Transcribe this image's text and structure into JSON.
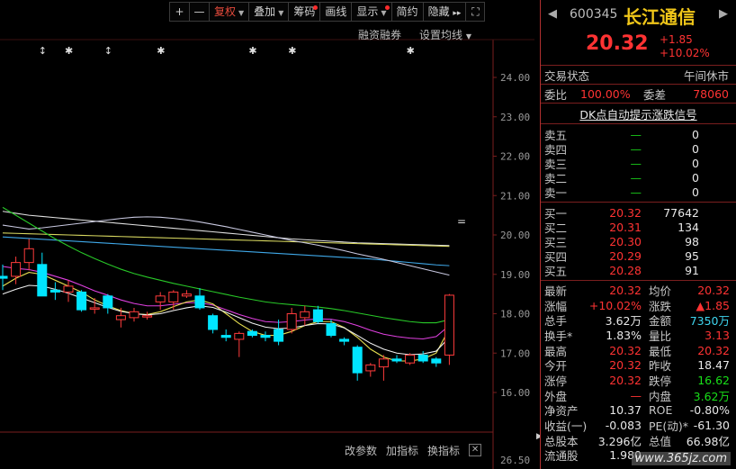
{
  "toolbar": {
    "zoom_in": "+",
    "zoom_out": "—",
    "fuquan": "复权",
    "overlay": "叠加",
    "chips": "筹码",
    "draw": "画线",
    "display": "显示",
    "simple": "简约",
    "hide": "隐藏",
    "collapse": "▸▸",
    "fullscreen": "⛶"
  },
  "sub_toolbar": {
    "margin": "融资融券",
    "ma_settings": "设置均线"
  },
  "bottom_toolbar": {
    "change_params": "改参数",
    "add_indicator": "加指标",
    "switch_indicator": "换指标",
    "close": "✕"
  },
  "chart_data": {
    "type": "candlestick",
    "yticks": [
      "24.00",
      "23.00",
      "22.00",
      "21.00",
      "20.00",
      "19.00",
      "18.00",
      "17.00",
      "16.00"
    ],
    "ylim": [
      15.8,
      24.2
    ],
    "lower_pane_tick": "26.50",
    "markers": [
      "↕",
      "✱",
      "↕",
      "✱",
      "✱",
      "✱",
      "✱"
    ],
    "candles": [
      {
        "o": 18.95,
        "h": 19.25,
        "l": 18.6,
        "c": 18.9
      },
      {
        "o": 18.95,
        "h": 19.45,
        "l": 18.75,
        "c": 19.3
      },
      {
        "o": 19.3,
        "h": 19.9,
        "l": 19.1,
        "c": 19.65
      },
      {
        "o": 19.25,
        "h": 19.55,
        "l": 18.5,
        "c": 18.45
      },
      {
        "o": 18.6,
        "h": 18.8,
        "l": 18.35,
        "c": 18.55
      },
      {
        "o": 18.55,
        "h": 18.85,
        "l": 18.3,
        "c": 18.7
      },
      {
        "o": 18.55,
        "h": 18.6,
        "l": 18.05,
        "c": 18.1
      },
      {
        "o": 18.15,
        "h": 18.4,
        "l": 18.0,
        "c": 18.15
      },
      {
        "o": 18.45,
        "h": 18.5,
        "l": 18.0,
        "c": 18.15
      },
      {
        "o": 17.85,
        "h": 18.15,
        "l": 17.65,
        "c": 17.95
      },
      {
        "o": 17.9,
        "h": 18.15,
        "l": 17.8,
        "c": 18.05
      },
      {
        "o": 17.95,
        "h": 18.05,
        "l": 17.85,
        "c": 17.95
      },
      {
        "o": 18.3,
        "h": 18.55,
        "l": 18.1,
        "c": 18.45
      },
      {
        "o": 18.3,
        "h": 18.6,
        "l": 18.1,
        "c": 18.55
      },
      {
        "o": 18.45,
        "h": 18.6,
        "l": 18.4,
        "c": 18.5
      },
      {
        "o": 18.45,
        "h": 18.65,
        "l": 18.1,
        "c": 18.15
      },
      {
        "o": 17.95,
        "h": 18.0,
        "l": 17.5,
        "c": 17.6
      },
      {
        "o": 17.45,
        "h": 17.6,
        "l": 17.3,
        "c": 17.4
      },
      {
        "o": 17.35,
        "h": 17.55,
        "l": 16.9,
        "c": 17.5
      },
      {
        "o": 17.55,
        "h": 17.6,
        "l": 17.4,
        "c": 17.45
      },
      {
        "o": 17.45,
        "h": 17.55,
        "l": 17.3,
        "c": 17.4
      },
      {
        "o": 17.6,
        "h": 17.85,
        "l": 17.2,
        "c": 17.3
      },
      {
        "o": 17.6,
        "h": 18.15,
        "l": 17.5,
        "c": 18.0
      },
      {
        "o": 17.9,
        "h": 18.2,
        "l": 17.7,
        "c": 18.05
      },
      {
        "o": 18.1,
        "h": 18.2,
        "l": 17.75,
        "c": 17.8
      },
      {
        "o": 17.75,
        "h": 17.85,
        "l": 17.4,
        "c": 17.45
      },
      {
        "o": 17.35,
        "h": 17.4,
        "l": 17.2,
        "c": 17.3
      },
      {
        "o": 17.15,
        "h": 17.2,
        "l": 16.3,
        "c": 16.5
      },
      {
        "o": 16.55,
        "h": 16.75,
        "l": 16.4,
        "c": 16.7
      },
      {
        "o": 16.65,
        "h": 16.95,
        "l": 16.3,
        "c": 16.85
      },
      {
        "o": 16.85,
        "h": 16.95,
        "l": 16.75,
        "c": 16.8
      },
      {
        "o": 16.75,
        "h": 17.0,
        "l": 16.7,
        "c": 16.95
      },
      {
        "o": 16.95,
        "h": 17.05,
        "l": 16.75,
        "c": 16.8
      },
      {
        "o": 16.85,
        "h": 16.9,
        "l": 16.65,
        "c": 16.75
      },
      {
        "o": 16.95,
        "h": 18.5,
        "l": 16.7,
        "c": 18.47
      }
    ],
    "series": [
      {
        "values": [
          20.6,
          20.55,
          20.5,
          20.47,
          20.44,
          20.41,
          20.38,
          20.35,
          20.32,
          20.29,
          20.26,
          20.23,
          20.2,
          20.17,
          20.14,
          20.11,
          20.08,
          20.05,
          20.02,
          19.99,
          19.96,
          19.93,
          19.9,
          19.88,
          19.86,
          19.84,
          19.82,
          19.8,
          19.79,
          19.78,
          19.77,
          19.76,
          19.75,
          19.74,
          19.73
        ],
        "color": "#e0e0e0"
      },
      {
        "values": [
          20.05,
          20.04,
          20.03,
          20.02,
          20.01,
          20.0,
          19.99,
          19.98,
          19.97,
          19.96,
          19.95,
          19.94,
          19.93,
          19.92,
          19.91,
          19.9,
          19.89,
          19.88,
          19.87,
          19.86,
          19.85,
          19.84,
          19.83,
          19.82,
          19.81,
          19.8,
          19.79,
          19.78,
          19.77,
          19.76,
          19.75,
          19.74,
          19.73,
          19.72,
          19.71
        ],
        "color": "#d8d860"
      },
      {
        "values": [
          19.95,
          19.93,
          19.91,
          19.89,
          19.87,
          19.85,
          19.83,
          19.81,
          19.79,
          19.77,
          19.75,
          19.73,
          19.71,
          19.69,
          19.67,
          19.65,
          19.63,
          19.61,
          19.59,
          19.57,
          19.55,
          19.53,
          19.51,
          19.49,
          19.47,
          19.45,
          19.43,
          19.41,
          19.39,
          19.36,
          19.33,
          19.3,
          19.27,
          19.24,
          19.22
        ],
        "color": "#3fa8e8"
      },
      {
        "values": [
          20.25,
          20.2,
          20.15,
          20.18,
          20.22,
          20.26,
          20.3,
          20.34,
          20.38,
          20.42,
          20.45,
          20.46,
          20.45,
          20.42,
          20.38,
          20.33,
          20.27,
          20.21,
          20.14,
          20.07,
          20.0,
          19.93,
          19.86,
          19.8,
          19.74,
          19.67,
          19.6,
          19.52,
          19.45,
          19.38,
          19.3,
          19.22,
          19.14,
          19.06,
          18.98
        ],
        "color": "#c8c8e0"
      },
      {
        "values": [
          20.7,
          20.5,
          20.3,
          20.1,
          19.9,
          19.72,
          19.55,
          19.4,
          19.26,
          19.13,
          19.02,
          18.93,
          18.85,
          18.77,
          18.7,
          18.63,
          18.56,
          18.49,
          18.42,
          18.36,
          18.3,
          18.26,
          18.23,
          18.2,
          18.17,
          18.13,
          18.08,
          18.02,
          17.96,
          17.9,
          17.85,
          17.8,
          17.77,
          17.77,
          17.85
        ],
        "color": "#28c828"
      },
      {
        "values": [
          19.2,
          19.15,
          19.12,
          19.05,
          18.95,
          18.85,
          18.72,
          18.58,
          18.47,
          18.35,
          18.26,
          18.2,
          18.2,
          18.24,
          18.28,
          18.28,
          18.22,
          18.1,
          17.98,
          17.88,
          17.8,
          17.78,
          17.8,
          17.84,
          17.87,
          17.86,
          17.8,
          17.7,
          17.58,
          17.48,
          17.42,
          17.38,
          17.36,
          17.42,
          17.7
        ],
        "color": "#e040e0"
      },
      {
        "values": [
          18.7,
          18.9,
          19.05,
          19.0,
          18.85,
          18.7,
          18.55,
          18.35,
          18.2,
          18.08,
          18.0,
          17.98,
          18.05,
          18.18,
          18.3,
          18.35,
          18.25,
          18.0,
          17.75,
          17.55,
          17.45,
          17.45,
          17.55,
          17.7,
          17.8,
          17.8,
          17.65,
          17.4,
          17.1,
          16.9,
          16.8,
          16.8,
          16.85,
          17.0,
          17.62
        ],
        "color": "#e8e050"
      },
      {
        "values": [
          18.5,
          18.62,
          18.72,
          18.7,
          18.62,
          18.52,
          18.4,
          18.28,
          18.16,
          18.06,
          18.0,
          17.97,
          18.0,
          18.08,
          18.15,
          18.2,
          18.16,
          18.04,
          17.9,
          17.76,
          17.66,
          17.62,
          17.64,
          17.7,
          17.75,
          17.74,
          17.64,
          17.45,
          17.25,
          17.1,
          17.0,
          16.96,
          16.98,
          17.05,
          17.4
        ],
        "color": "#f0f0f0"
      }
    ],
    "end_marker": "="
  },
  "panel": {
    "code": "600345",
    "name": "长江通信",
    "price": "20.32",
    "change": "+1.85",
    "change_pct": "+10.02%",
    "left_arrow": "◀",
    "right_arrow": "▶",
    "status_label": "交易状态",
    "status_value": "午间休市",
    "weibi_label": "委比",
    "weibi_value": "100.00%",
    "weicha_label": "委差",
    "weicha_value": "78060",
    "dk_link": "DK点自动提示涨跌信号",
    "sell": [
      {
        "name": "卖五",
        "price": "—",
        "vol": "0"
      },
      {
        "name": "卖四",
        "price": "—",
        "vol": "0"
      },
      {
        "name": "卖三",
        "price": "—",
        "vol": "0"
      },
      {
        "name": "卖二",
        "price": "—",
        "vol": "0"
      },
      {
        "name": "卖一",
        "price": "—",
        "vol": "0"
      }
    ],
    "buy": [
      {
        "name": "买一",
        "price": "20.32",
        "vol": "77642"
      },
      {
        "name": "买二",
        "price": "20.31",
        "vol": "134"
      },
      {
        "name": "买三",
        "price": "20.30",
        "vol": "98"
      },
      {
        "name": "买四",
        "price": "20.29",
        "vol": "95"
      },
      {
        "name": "买五",
        "price": "20.28",
        "vol": "91"
      }
    ],
    "stats": [
      {
        "k1": "最新",
        "v1": "20.32",
        "c1": "red",
        "k2": "均价",
        "v2": "20.32",
        "c2": "red"
      },
      {
        "k1": "涨幅",
        "v1": "+10.02%",
        "c1": "red",
        "k2": "涨跌",
        "v2": "▲1.85",
        "c2": "red"
      },
      {
        "k1": "总手",
        "v1": "3.62万",
        "c1": "white",
        "k2": "金额",
        "v2": "7350万",
        "c2": "cyan"
      },
      {
        "k1": "换手*",
        "v1": "1.83%",
        "c1": "white",
        "k2": "量比",
        "v2": "3.13",
        "c2": "red"
      },
      {
        "k1": "最高",
        "v1": "20.32",
        "c1": "red",
        "k2": "最低",
        "v2": "20.32",
        "c2": "red"
      },
      {
        "k1": "今开",
        "v1": "20.32",
        "c1": "red",
        "k2": "昨收",
        "v2": "18.47",
        "c2": "white"
      },
      {
        "k1": "涨停",
        "v1": "20.32",
        "c1": "red",
        "k2": "跌停",
        "v2": "16.62",
        "c2": "green"
      },
      {
        "k1": "外盘",
        "v1": "—",
        "c1": "red",
        "k2": "内盘",
        "v2": "3.62万",
        "c2": "green"
      },
      {
        "k1": "净资产",
        "v1": "10.37",
        "c1": "white",
        "k2": "ROE",
        "v2": "-0.80%",
        "c2": "white"
      },
      {
        "k1": "收益(一)",
        "v1": "-0.083",
        "c1": "white",
        "k2": "PE(动)*",
        "v2": "-61.30",
        "c2": "white"
      },
      {
        "k1": "总股本",
        "v1": "3.296亿",
        "c1": "white",
        "k2": "总值",
        "v2": "66.98亿",
        "c2": "white"
      },
      {
        "k1": "流通股",
        "v1": "1.980",
        "c1": "white",
        "k2": "",
        "v2": "",
        "c2": "white"
      }
    ],
    "side_arrow": "▶",
    "watermark": "www.365jz.com"
  },
  "colors": {
    "up": "#ff3b3b",
    "down": "#00e5ff",
    "axis": "#3a1515",
    "grid_line": "#555555"
  }
}
